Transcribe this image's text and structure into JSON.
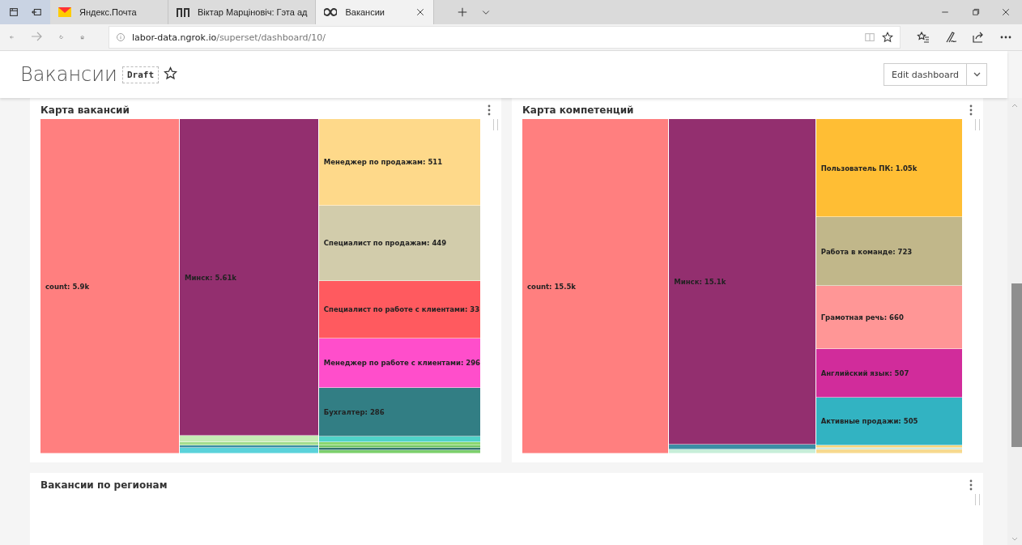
{
  "browser": {
    "tabs": [
      {
        "title": "Яндекс.Почта",
        "kind": "mail",
        "selected": false
      },
      {
        "title": "Віктар Марціновіч: Гэта ад",
        "kind": "logo",
        "selected": false
      },
      {
        "title": "Вакансии",
        "kind": "infinity",
        "selected": true
      }
    ],
    "address": {
      "host": "labor-data.ngrok.io",
      "path": "/superset/dashboard/10/"
    }
  },
  "dashboard": {
    "title": "Вакансии",
    "badge": "Draft",
    "favorite": false,
    "edit_button": "Edit dashboard"
  },
  "charts": [
    {
      "title": "Карта вакансий",
      "kind": "treemap",
      "columns": [
        {
          "cells": [
            {
              "label": "count: 5.9k",
              "color": "#ff7f7f"
            }
          ]
        },
        {
          "cells": [
            {
              "label": "Минск: 5.61k",
              "color": "#932f6f"
            },
            {
              "color": "#c6ecb5"
            },
            {
              "color": "#a4dd8e"
            },
            {
              "color": "#3b8ea5"
            },
            {
              "color": "#5ad2da"
            }
          ]
        },
        {
          "cells": [
            {
              "label": "Менеджер по продажам: 511",
              "color": "#fed98a"
            },
            {
              "label": "Специалист по продажам: 449",
              "color": "#d2ccab"
            },
            {
              "label": "Специалист по работе с клиентами: 33",
              "color": "#ff5a5f"
            },
            {
              "label": "Менеджер по работе с клиентами: 296",
              "color": "#ff4ecb"
            },
            {
              "label": "Бухгалтер: 286",
              "color": "#327e84"
            },
            {
              "color": "#4fd3c9"
            },
            {
              "color": "#8bd66f"
            },
            {
              "color": "#71c562"
            },
            {
              "color": "#33736d"
            },
            {
              "color": "#7ccf6b"
            }
          ]
        }
      ]
    },
    {
      "title": "Карта компетенций",
      "kind": "treemap",
      "columns": [
        {
          "cells": [
            {
              "label": "count: 15.5k",
              "color": "#ff7f7f"
            }
          ]
        },
        {
          "cells": [
            {
              "label": "Минск: 15.1k",
              "color": "#932f6f"
            },
            {
              "color": "#3b8ea5"
            },
            {
              "color": "#c7eed9"
            }
          ]
        },
        {
          "cells": [
            {
              "label": "Пользователь ПК: 1.05k",
              "color": "#ffbe34"
            },
            {
              "label": "Работа в команде: 723",
              "color": "#c1b78a"
            },
            {
              "label": "Грамотная речь: 660",
              "color": "#ff9696"
            },
            {
              "label": "Английский язык: 507",
              "color": "#d12c9b"
            },
            {
              "label": "Активные продажи: 505",
              "color": "#32b3c2"
            },
            {
              "color": "#f6d57a"
            },
            {
              "color": "#c8e6dc"
            },
            {
              "color": "#f7d98e"
            }
          ]
        }
      ]
    },
    {
      "title": "Вакансии по регионам",
      "kind": "empty"
    }
  ]
}
